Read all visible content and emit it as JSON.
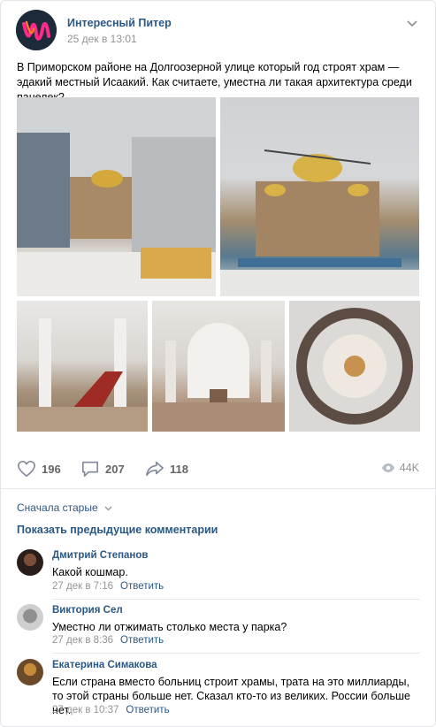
{
  "post": {
    "author": "Интересный Питер",
    "date": "25 дек в 13:01",
    "text": "В Приморском районе на Долгоозерной улице который год строят храм — эдакий местный Исаакий. Как считаете, уместна ли такая архитектура среди панелек?",
    "brand_colors": [
      "#ff2a8a",
      "#ff6a2a",
      "#1c2a3a"
    ]
  },
  "actions": {
    "likes": "196",
    "comments": "207",
    "shares": "118",
    "views": "44K"
  },
  "comments_section": {
    "sort_label": "Сначала старые",
    "show_previous": "Показать предыдущие комментарии",
    "items": [
      {
        "name": "Дмитрий Степанов",
        "text": "Какой кошмар.",
        "date": "27 дек в 7:16",
        "reply": "Ответить"
      },
      {
        "name": "Виктория Сел",
        "text": "Уместно ли отжимать столько места у парка?",
        "date": "27 дек в 8:36",
        "reply": "Ответить"
      },
      {
        "name": "Екатерина Симакова",
        "text": "Если страна вместо больниц строит храмы, трата на это миллиарды, то этой страны больше нет. Сказал кто-то из великих. России больше нет.",
        "date": "27 дек в 10:37",
        "reply": "Ответить"
      }
    ]
  },
  "icons": [
    "heart-icon",
    "comment-icon",
    "share-icon",
    "eye-icon",
    "chevron-down-icon"
  ],
  "accent": "#2a5885"
}
